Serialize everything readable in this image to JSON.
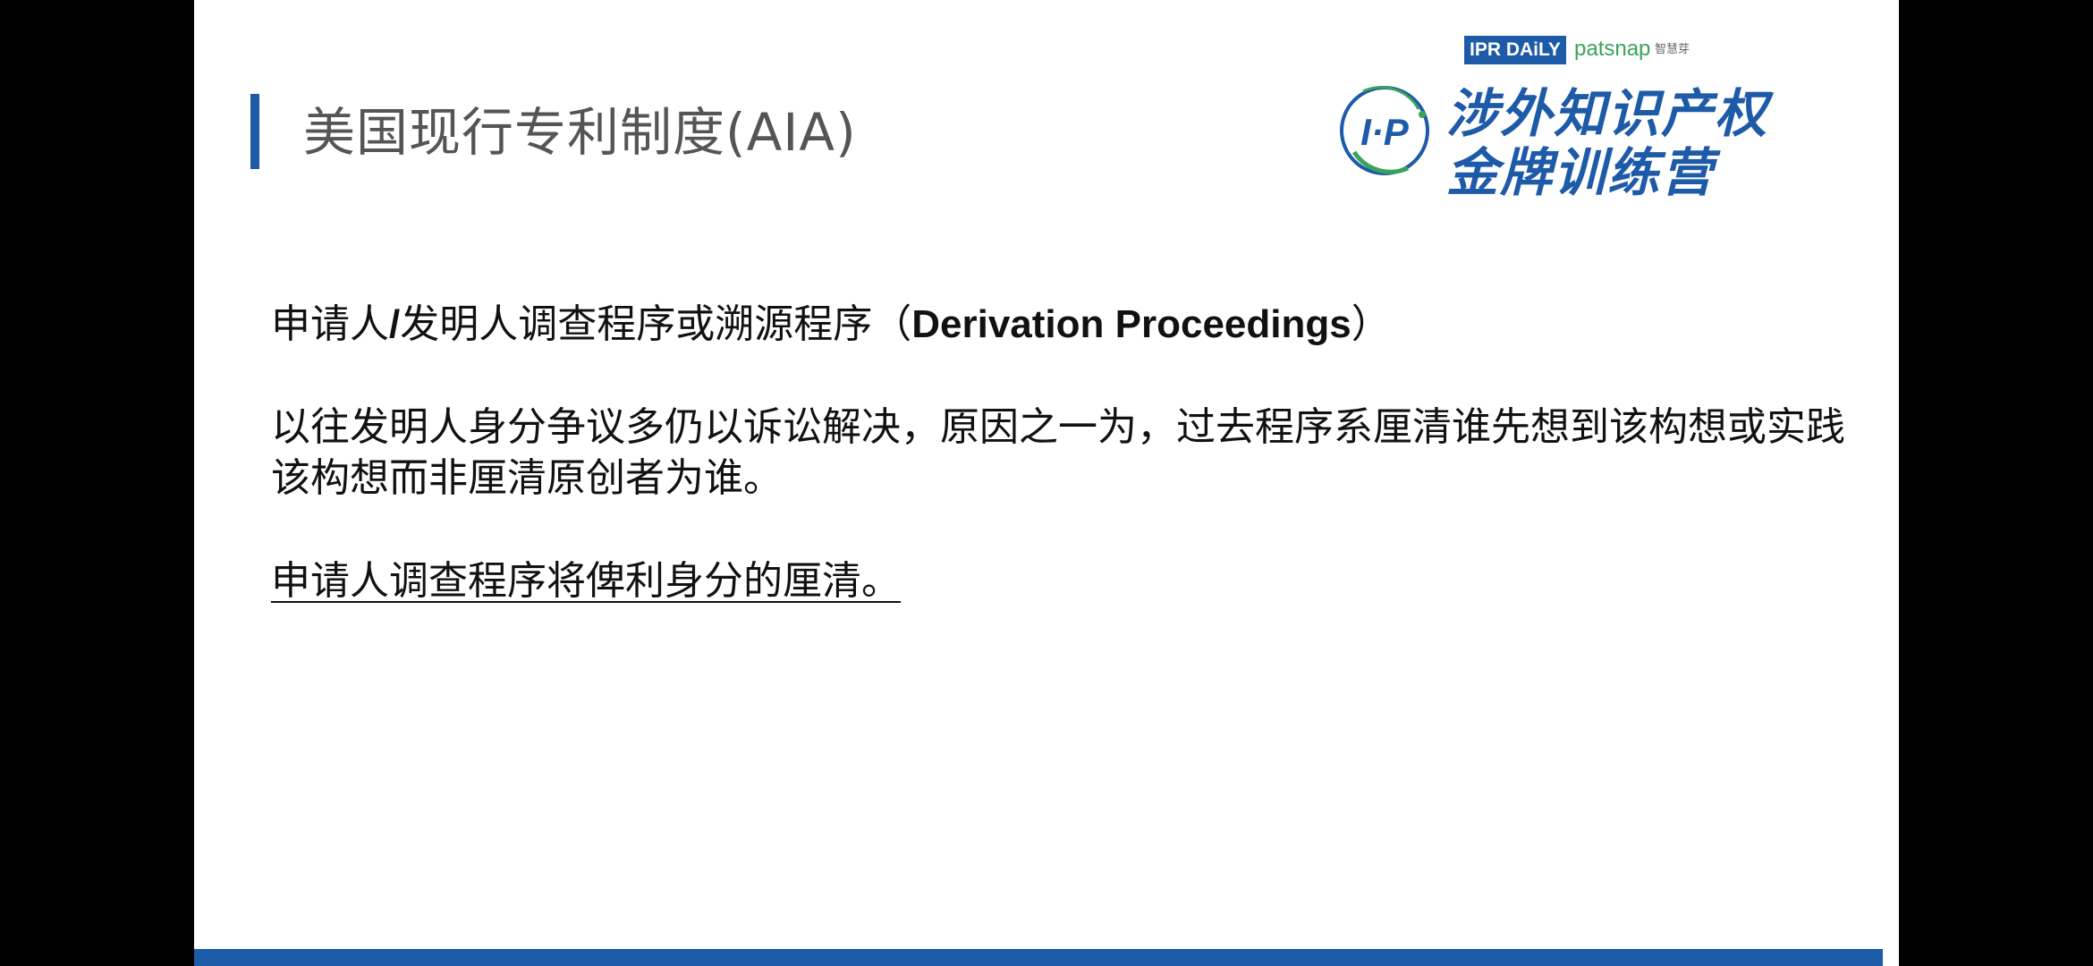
{
  "slide": {
    "title": "美国现行专利制度(AIA)",
    "logos": {
      "ipr_daily": "IPR DAiLY",
      "patsnap": "patsnap",
      "patsnap_cn": "智慧芽",
      "ip_mark": "I·P",
      "camp_line_1": "涉外知识产权",
      "camp_line_2": "金牌训练营"
    },
    "paragraph_1": {
      "prefix": "申请人",
      "slash": "/",
      "middle": "发明人调查程序或溯源程序（",
      "english": "Derivation Proceedings",
      "suffix": "）"
    },
    "paragraph_2": "以往发明人身分争议多仍以诉讼解决，原因之一为，过去程序系厘清谁先想到该构想或实践该构想而非厘清原创者为谁。",
    "paragraph_3": "申请人调查程序将俾利身分的厘清。"
  },
  "colors": {
    "accent": "#1d5aa8",
    "green": "#3aa35b",
    "title_gray": "#555555"
  }
}
